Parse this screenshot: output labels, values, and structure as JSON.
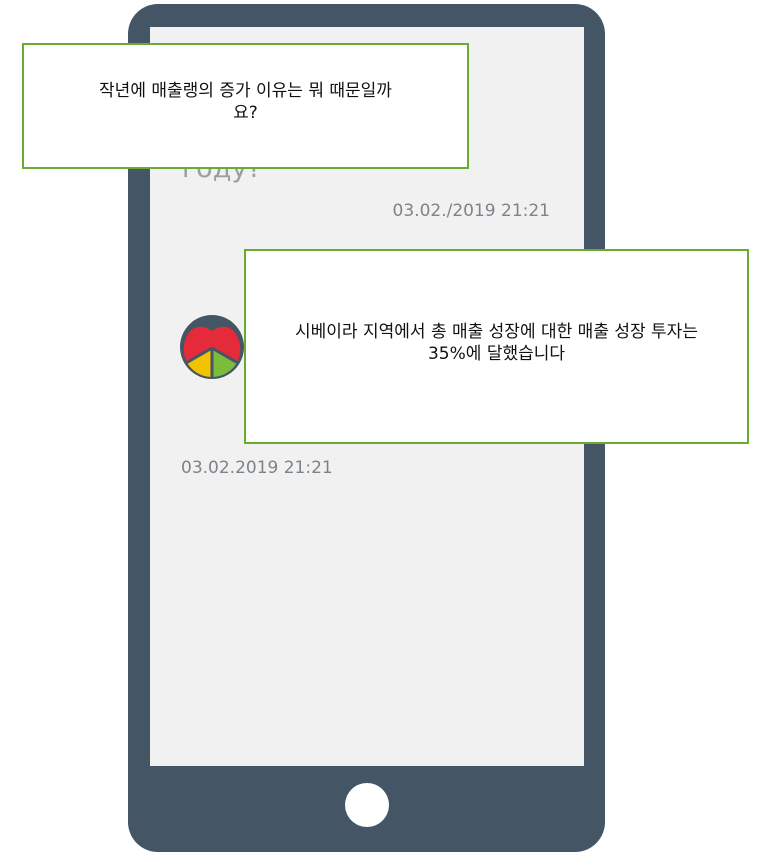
{
  "conversation": {
    "question_overlay": "작년에 매출랭의 증가 이유는 뭐 때문일까요?",
    "answer_overlay": "시베이라 지역에서 총 매출 성장에 대한 매출 성장 투자는 35%에 달했습니다",
    "partial_message_text": "году?",
    "message_1_timestamp": "03.02./2019  21:21",
    "message_2_timestamp": "03.02.2019  21:21"
  },
  "icons": {
    "user_avatar": "user-avatar-photo",
    "bot_avatar": "bot-logo-icon",
    "home": "home-button-icon"
  },
  "colors": {
    "phone_body": "#445566",
    "screen_background": "#f1f1f1",
    "callout_border": "#6aab2f",
    "timestamp_text": "#7d838a",
    "logo_red": "#e52a3a",
    "logo_yellow": "#f4c300",
    "logo_green": "#7bbd3a"
  }
}
